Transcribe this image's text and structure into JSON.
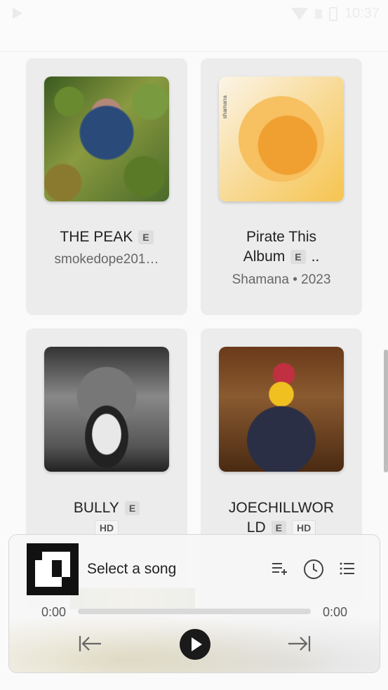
{
  "status_bar": {
    "time": "10:37"
  },
  "albums": [
    {
      "title_line1": "THE PEAK",
      "title_line2": "",
      "explicit": "E",
      "subtitle": "smokedope201…",
      "quality": ""
    },
    {
      "title_line1": "Pirate This",
      "title_line2": "Album",
      "explicit": "E",
      "ellipsis": "..",
      "subtitle": "Shamana • 2023",
      "art_text": "shamana",
      "quality": ""
    },
    {
      "title_line1": "BULLY",
      "title_line2": "",
      "explicit": "E",
      "subtitle": "",
      "quality": "HD"
    },
    {
      "title_line1": "JOECHILLWOR",
      "title_line2": "LD",
      "explicit": "E",
      "subtitle": "",
      "quality": "HD"
    }
  ],
  "player": {
    "song_title": "Select a song",
    "time_elapsed": "0:00",
    "time_total": "0:00",
    "progress": 0
  }
}
